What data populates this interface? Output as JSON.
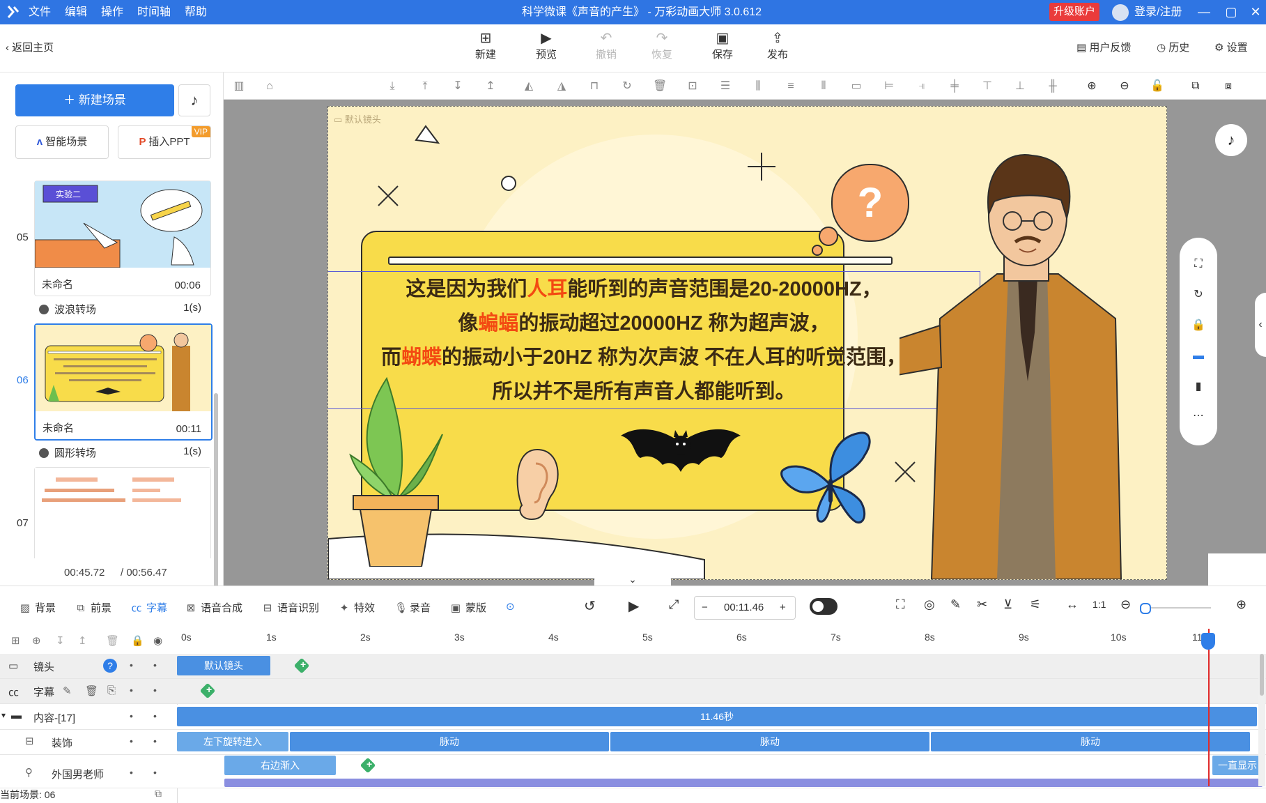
{
  "app": {
    "title": "科学微课《声音的产生》 - 万彩动画大师 3.0.612",
    "menu": [
      "文件",
      "编辑",
      "操作",
      "时间轴",
      "帮助"
    ],
    "upgrade": "升级账户",
    "login": "登录/注册"
  },
  "toolbar": {
    "back": "返回主页",
    "new": "新建",
    "preview": "预览",
    "undo": "撤销",
    "redo": "恢复",
    "save": "保存",
    "publish": "发布",
    "feedback": "用户反馈",
    "history": "历史",
    "settings": "设置"
  },
  "left": {
    "new_scene": "新建场景",
    "smart_scene": "智能场景",
    "insert_ppt": "插入PPT",
    "vip": "VIP",
    "scenes": [
      {
        "num": "05",
        "name": "未命名",
        "time": "00:06",
        "transition": "波浪转场",
        "trans_dur": "1(s)",
        "badge": "实验二"
      },
      {
        "num": "06",
        "name": "未命名",
        "time": "00:11",
        "transition": "圆形转场",
        "trans_dur": "1(s)"
      },
      {
        "num": "07",
        "name": "",
        "time": ""
      }
    ],
    "current_time": "00:45.72",
    "total_time": "/ 00:56.47"
  },
  "canvas": {
    "camera_label": "默认镜头",
    "lesson_line1_a": "这是因为我们",
    "lesson_line1_hl": "人耳",
    "lesson_line1_b": "能听到的声音范围是20-20000HZ，",
    "lesson_line2_a": "像",
    "lesson_line2_hl": "蝙蝠",
    "lesson_line2_b": "的振动超过20000HZ 称为超声波，",
    "lesson_line3_a": "而",
    "lesson_line3_hl": "蝴蝶",
    "lesson_line3_b": "的振动小于20HZ 称为次声波 不在人耳的听觉范围，",
    "lesson_line4": "所以并不是所有声音人都能听到。",
    "question_mark": "?"
  },
  "timeline": {
    "tabs": [
      "背景",
      "前景",
      "字幕",
      "语音合成",
      "语音识别",
      "特效",
      "录音",
      "蒙版"
    ],
    "active_tab": "字幕",
    "current_time": "00:11.46",
    "ruler": [
      "0s",
      "1s",
      "2s",
      "3s",
      "4s",
      "5s",
      "6s",
      "7s",
      "8s",
      "9s",
      "10s",
      "11"
    ],
    "tracks": {
      "camera": {
        "label": "镜头",
        "bar": "默认镜头"
      },
      "subtitle": {
        "label": "字幕"
      },
      "content": {
        "label": "内容-[17]",
        "bar": "11.46秒"
      },
      "decor": {
        "label": "装饰",
        "enter": "左下旋转进入",
        "pulse": [
          "脉动",
          "脉动",
          "脉动"
        ],
        "end": ""
      },
      "teacher": {
        "label": "外国男老师",
        "enter": "右边渐入",
        "end": "一直显示"
      }
    },
    "current_scene": "当前场景: 06"
  },
  "colors": {
    "brand": "#2f75e3",
    "accent": "#2f7ee8",
    "upgrade": "#ea3b3b",
    "highlight": "#f34a12",
    "board": "#f8dc4a",
    "stage": "#fdf1c4",
    "keyframe": "#3cb06a",
    "playhead": "#e02a2a"
  }
}
